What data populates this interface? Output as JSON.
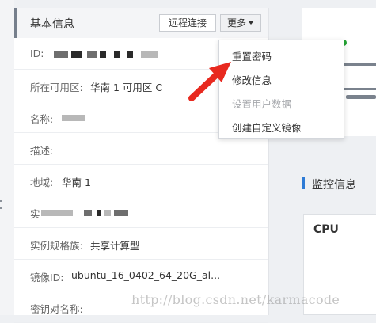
{
  "info_panel": {
    "title": "基本信息",
    "remote_button": "远程连接",
    "more_button": "更多",
    "rows": [
      {
        "key": "ID:",
        "value": ""
      },
      {
        "key": "所在可用区:",
        "value": "华南 1 可用区 C"
      },
      {
        "key": "名称:",
        "value": ""
      },
      {
        "key": "描述:",
        "value": ""
      },
      {
        "key": "地域:",
        "value": "华南 1"
      },
      {
        "key": "实",
        "value": ""
      },
      {
        "key": "实例规格族:",
        "value": "共享计算型"
      },
      {
        "key": "镜像ID:",
        "value": "ubuntu_16_0402_64_20G_al..."
      },
      {
        "key": "密钥对名称:",
        "value": ""
      }
    ]
  },
  "dropdown_menu": {
    "items": [
      {
        "label": "重置密码",
        "disabled": false
      },
      {
        "label": "修改信息",
        "disabled": false
      },
      {
        "label": "设置用户数据",
        "disabled": true
      },
      {
        "label": "创建自定义镜像",
        "disabled": false
      }
    ]
  },
  "monitor": {
    "title": "监控信息",
    "cpu_label": "CPU"
  },
  "watermark": "http://blog.csdn.net/karmacode",
  "colors": {
    "arrow": "#e8291f",
    "accent": "#2e7bd6",
    "status_green": "#25a535"
  },
  "icons": [
    "caret-down-icon",
    "monitor-icon",
    "annotation-arrow-icon"
  ]
}
